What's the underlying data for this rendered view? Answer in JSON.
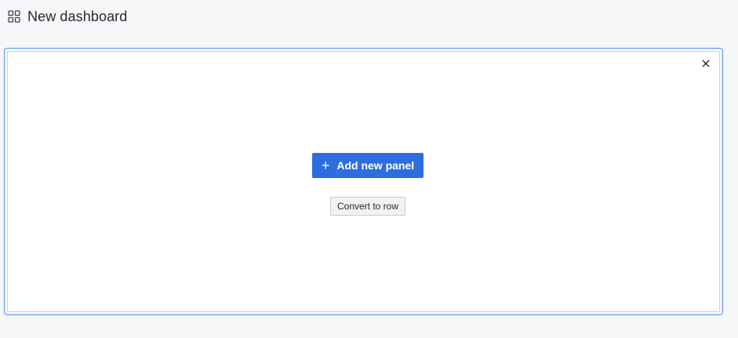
{
  "header": {
    "icon": "apps-grid-icon",
    "title": "New dashboard"
  },
  "panel": {
    "close_icon": "close-icon",
    "add_panel_label": "Add new panel",
    "add_panel_icon": "plus-icon",
    "convert_label": "Convert to row"
  },
  "colors": {
    "primary": "#2e6de0",
    "panel_border": "#5d93ef",
    "background": "#f6f7f9"
  }
}
